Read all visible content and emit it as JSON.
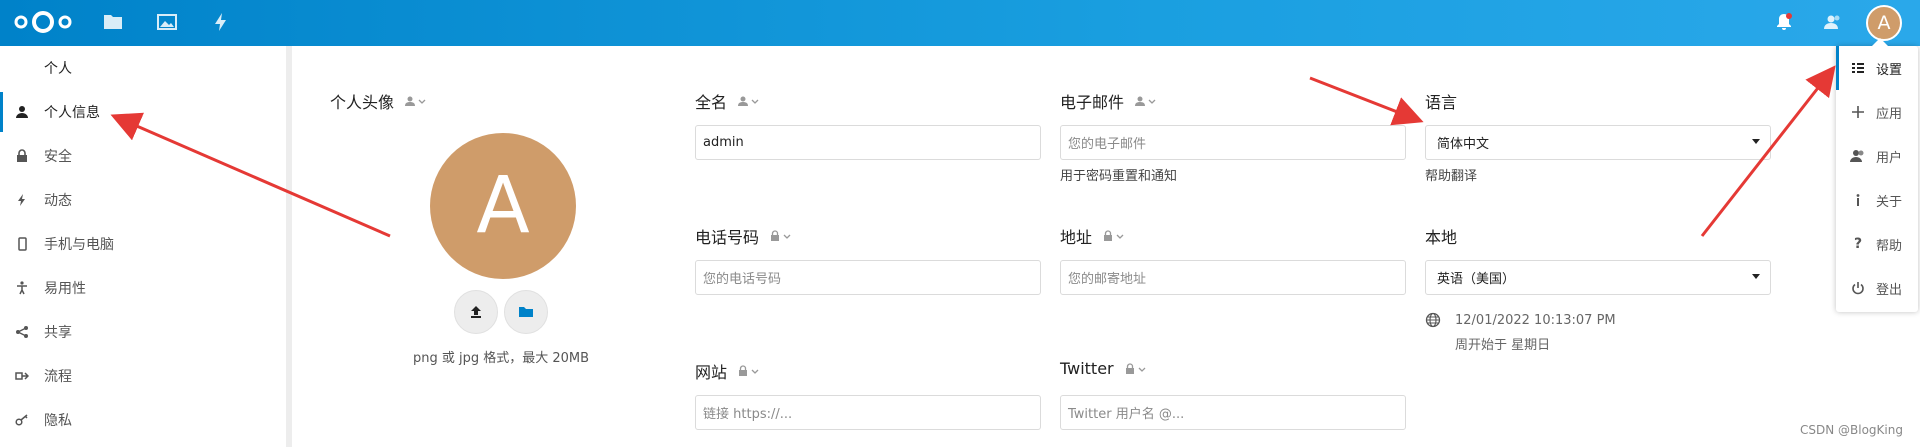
{
  "header": {
    "icons": [
      "nextcloud-logo",
      "files-icon",
      "photos-icon",
      "activity-icon",
      "notifications-icon",
      "contacts-icon"
    ],
    "avatar_letter": "A",
    "colors": {
      "primary": "#0082c9",
      "avatar": "#cf9c6a",
      "arrow": "#e53935"
    }
  },
  "sidebar": {
    "heading": "个人",
    "items": [
      {
        "label": "个人信息",
        "icon": "user-icon"
      },
      {
        "label": "安全",
        "icon": "lock-icon"
      },
      {
        "label": "动态",
        "icon": "activity-icon"
      },
      {
        "label": "手机与电脑",
        "icon": "phone-icon"
      },
      {
        "label": "易用性",
        "icon": "accessibility-icon"
      },
      {
        "label": "共享",
        "icon": "share-icon"
      },
      {
        "label": "流程",
        "icon": "flow-icon"
      },
      {
        "label": "隐私",
        "icon": "key-icon"
      }
    ]
  },
  "profile": {
    "avatar_label": "个人头像",
    "avatar_letter": "A",
    "avatar_hint": "png 或 jpg 格式，最大 20MB",
    "fullname_label": "全名",
    "fullname_value": "admin",
    "email_label": "电子邮件",
    "email_placeholder": "您的电子邮件",
    "email_hint": "用于密码重置和通知",
    "language_label": "语言",
    "language_value": "简体中文",
    "language_hint": "帮助翻译",
    "phone_label": "电话号码",
    "phone_placeholder": "您的电话号码",
    "address_label": "地址",
    "address_placeholder": "您的邮寄地址",
    "locale_label": "本地",
    "locale_value": "英语（美国）",
    "locale_time": "12/01/2022 10:13:07 PM",
    "locale_week": "周开始于 星期日",
    "website_label": "网站",
    "website_placeholder": "链接 https://...",
    "twitter_label": "Twitter",
    "twitter_placeholder": "Twitter 用户名 @..."
  },
  "user_menu": {
    "items": [
      {
        "label": "设置",
        "icon": "settings-list-icon"
      },
      {
        "label": "应用",
        "icon": "plus-icon"
      },
      {
        "label": "用户",
        "icon": "users-icon"
      },
      {
        "label": "关于",
        "icon": "info-icon"
      },
      {
        "label": "帮助",
        "icon": "help-icon"
      },
      {
        "label": "登出",
        "icon": "power-icon"
      }
    ]
  },
  "watermark": "CSDN @BlogKing"
}
